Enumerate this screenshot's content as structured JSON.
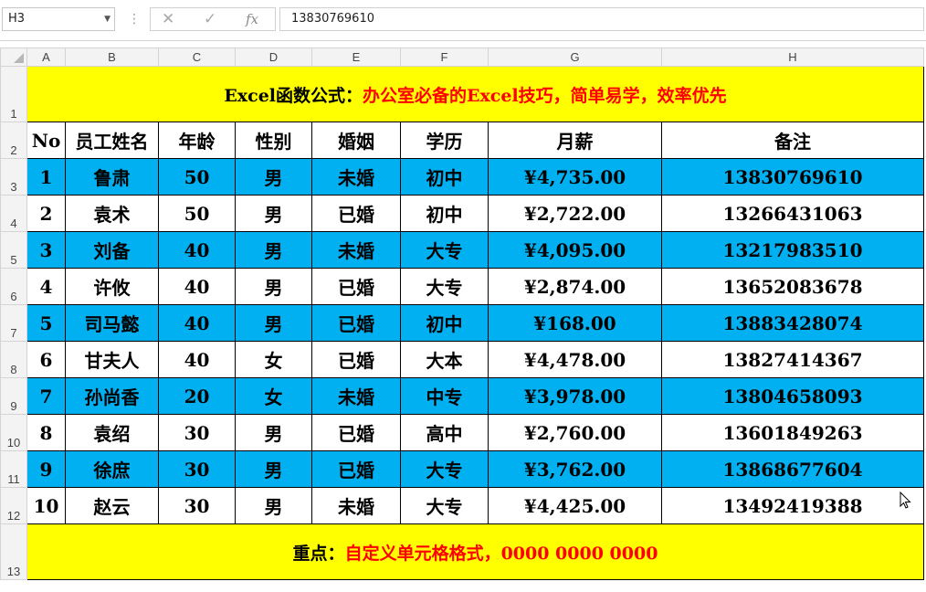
{
  "formula_bar": {
    "name_box": "H3",
    "dropdown_icon": "chevron-down-icon",
    "cancel_icon": "close-icon",
    "enter_icon": "check-icon",
    "function_label": "fx",
    "value": "13830769610"
  },
  "columns": [
    "A",
    "B",
    "C",
    "D",
    "E",
    "F",
    "G",
    "H"
  ],
  "row_numbers": [
    "1",
    "2",
    "3",
    "4",
    "5",
    "6",
    "7",
    "8",
    "9",
    "10",
    "11",
    "12",
    "13"
  ],
  "title": {
    "part1": "Excel函数公式：",
    "part2": "办公室必备的Excel技巧，简单易学，效率优先"
  },
  "table": {
    "headers": [
      "No",
      "员工姓名",
      "年龄",
      "性别",
      "婚姻",
      "学历",
      "月薪",
      "备注"
    ],
    "rows": [
      [
        "1",
        "鲁肃",
        "50",
        "男",
        "未婚",
        "初中",
        "¥4,735.00",
        "13830769610"
      ],
      [
        "2",
        "袁术",
        "50",
        "男",
        "已婚",
        "初中",
        "¥2,722.00",
        "13266431063"
      ],
      [
        "3",
        "刘备",
        "40",
        "男",
        "未婚",
        "大专",
        "¥4,095.00",
        "13217983510"
      ],
      [
        "4",
        "许攸",
        "40",
        "男",
        "已婚",
        "大专",
        "¥2,874.00",
        "13652083678"
      ],
      [
        "5",
        "司马懿",
        "40",
        "男",
        "已婚",
        "初中",
        "¥168.00",
        "13883428074"
      ],
      [
        "6",
        "甘夫人",
        "40",
        "女",
        "已婚",
        "大本",
        "¥4,478.00",
        "13827414367"
      ],
      [
        "7",
        "孙尚香",
        "20",
        "女",
        "未婚",
        "中专",
        "¥3,978.00",
        "13804658093"
      ],
      [
        "8",
        "袁绍",
        "30",
        "男",
        "已婚",
        "高中",
        "¥2,760.00",
        "13601849263"
      ],
      [
        "9",
        "徐庶",
        "30",
        "男",
        "已婚",
        "大专",
        "¥3,762.00",
        "13868677604"
      ],
      [
        "10",
        "赵云",
        "30",
        "男",
        "未婚",
        "大专",
        "¥4,425.00",
        "13492419388"
      ]
    ]
  },
  "note": {
    "part1": "重点：",
    "part2": "自定义单元格格式，0000  0000 0000"
  },
  "colors": {
    "title_fill": "#ffff00",
    "highlight_row": "#00b0f0",
    "accent_text": "#ff0000"
  }
}
